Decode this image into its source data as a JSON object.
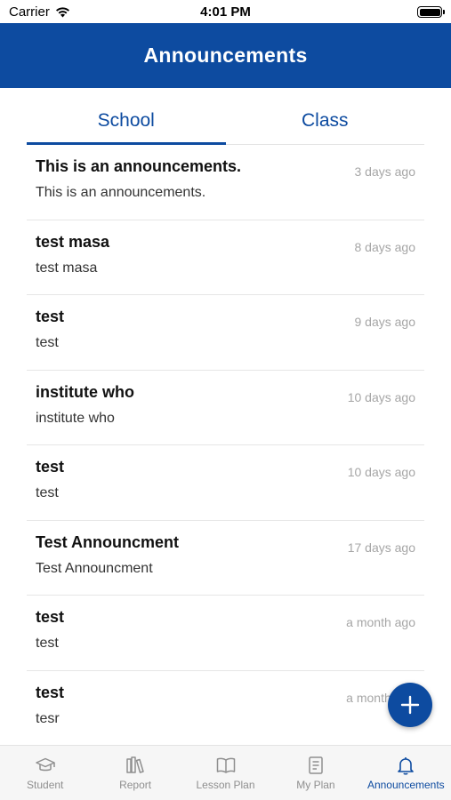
{
  "status_bar": {
    "carrier": "Carrier",
    "time": "4:01 PM"
  },
  "header": {
    "title": "Announcements"
  },
  "tabs": [
    {
      "label": "School",
      "active": true
    },
    {
      "label": "Class",
      "active": false
    }
  ],
  "announcements": [
    {
      "title": "This is an announcements.",
      "body": "This is an announcements.",
      "time": "3 days ago"
    },
    {
      "title": "test masa",
      "body": "test masa",
      "time": "8 days ago"
    },
    {
      "title": "test",
      "body": "test",
      "time": "9 days ago"
    },
    {
      "title": "institute who",
      "body": "institute who",
      "time": "10 days ago"
    },
    {
      "title": "test",
      "body": "test",
      "time": "10 days ago"
    },
    {
      "title": "Test Announcment",
      "body": "Test Announcment",
      "time": "17 days ago"
    },
    {
      "title": "test",
      "body": "test",
      "time": "a month ago"
    },
    {
      "title": "test",
      "body": "tesr",
      "time": "a month ago"
    }
  ],
  "fab": {
    "icon": "plus-icon"
  },
  "bottom_nav": [
    {
      "label": "Student",
      "icon": "graduation-cap-icon",
      "active": false
    },
    {
      "label": "Report",
      "icon": "books-icon",
      "active": false
    },
    {
      "label": "Lesson Plan",
      "icon": "open-book-icon",
      "active": false
    },
    {
      "label": "My Plan",
      "icon": "notebook-icon",
      "active": false
    },
    {
      "label": "Announcements",
      "icon": "bell-icon",
      "active": true
    }
  ],
  "colors": {
    "brand": "#0d4ba0",
    "muted": "#a6a6a6",
    "inactive_nav": "#8f8f8f"
  }
}
